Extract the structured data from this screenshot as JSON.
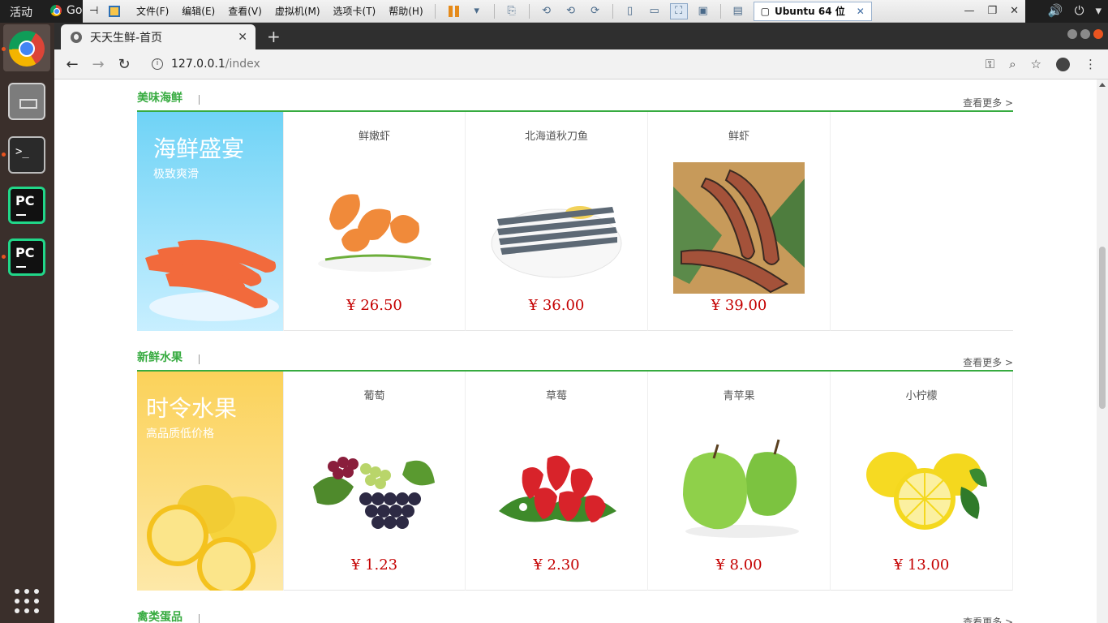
{
  "desktop": {
    "activities": "活动",
    "chrome_app": "Go"
  },
  "vmware": {
    "menus": [
      "文件(F)",
      "编辑(E)",
      "查看(V)",
      "虚拟机(M)",
      "选项卡(T)",
      "帮助(H)"
    ],
    "tab_label": "Ubuntu 64 位"
  },
  "browser": {
    "tab_title": "天天生鲜-首页",
    "url_host": "127.0.0.1",
    "url_path": "/index"
  },
  "sections": [
    {
      "title": "美味海鲜",
      "more": "查看更多 >",
      "banner_title": "海鲜盛宴",
      "banner_sub": "极致爽滑",
      "banner_color": "#6fd3f6",
      "products": [
        {
          "name": "鲜嫩虾",
          "price": "¥ 26.50"
        },
        {
          "name": "北海道秋刀鱼",
          "price": "¥ 36.00"
        },
        {
          "name": "鲜虾",
          "price": "¥ 39.00"
        }
      ]
    },
    {
      "title": "新鲜水果",
      "more": "查看更多 >",
      "banner_title": "时令水果",
      "banner_sub": "高品质低价格",
      "banner_color": "#fbd25a",
      "products": [
        {
          "name": "葡萄",
          "price": "¥ 1.23"
        },
        {
          "name": "草莓",
          "price": "¥ 2.30"
        },
        {
          "name": "青苹果",
          "price": "¥ 8.00"
        },
        {
          "name": "小柠檬",
          "price": "¥ 13.00"
        }
      ]
    },
    {
      "title": "禽类蛋品",
      "more": "查看更多 >"
    }
  ]
}
